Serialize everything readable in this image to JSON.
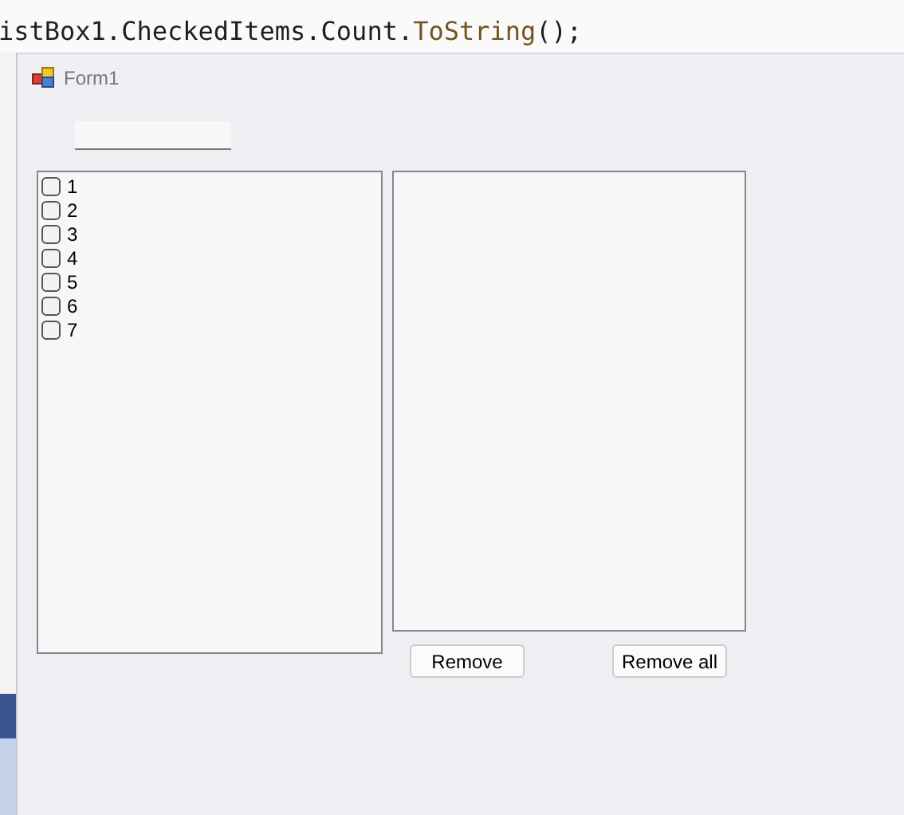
{
  "code_line": [
    {
      "text": "istBox1.CheckedItems.Count.",
      "kind": "plain"
    },
    {
      "text": "ToString",
      "kind": "method"
    },
    {
      "text": "();",
      "kind": "plain"
    }
  ],
  "window": {
    "title": "Form1"
  },
  "checked_list": {
    "items": [
      {
        "label": "1",
        "checked": false
      },
      {
        "label": "2",
        "checked": false
      },
      {
        "label": "3",
        "checked": false
      },
      {
        "label": "4",
        "checked": false
      },
      {
        "label": "5",
        "checked": false
      },
      {
        "label": "6",
        "checked": false
      },
      {
        "label": "7",
        "checked": false
      }
    ]
  },
  "buttons": [
    "Remove",
    "Remove all"
  ]
}
